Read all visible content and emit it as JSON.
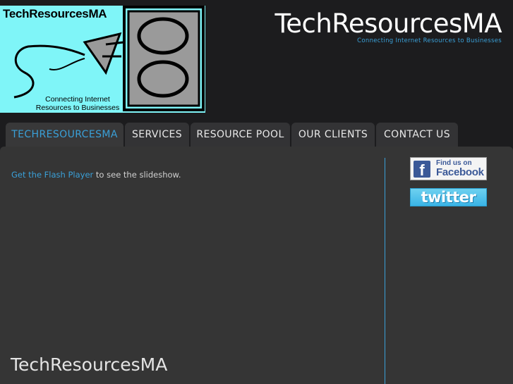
{
  "logo": {
    "title": "TechResourcesMA",
    "tagline": "Connecting Internet Resources to Businesses"
  },
  "header": {
    "site_title": "TechResourcesMA",
    "tagline": "Connecting Internet Resources to Businesses"
  },
  "nav": {
    "tabs": [
      {
        "label": "TECHRESOURCESMA",
        "active": true
      },
      {
        "label": "SERVICES",
        "active": false
      },
      {
        "label": "RESOURCE POOL",
        "active": false
      },
      {
        "label": "OUR CLIENTS",
        "active": false
      },
      {
        "label": "CONTACT US",
        "active": false
      }
    ]
  },
  "main": {
    "flash_link": "Get the Flash Player",
    "flash_text": " to see the slideshow.",
    "footer_title": "TechResourcesMA"
  },
  "social": {
    "facebook_line1": "Find us on",
    "facebook_line2": "Facebook",
    "facebook_icon": "f",
    "twitter_label": "twitter"
  },
  "colors": {
    "accent": "#3aa0d8",
    "logo_bg": "#7ff5f8",
    "page_bg": "#1c1c1e",
    "content_bg": "#353535"
  }
}
